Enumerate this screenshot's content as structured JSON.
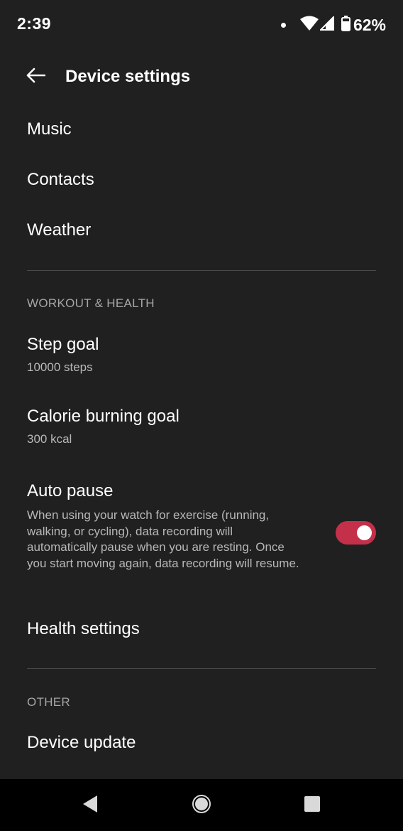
{
  "status_bar": {
    "time": "2:39",
    "battery": "62%"
  },
  "header": {
    "title": "Device settings"
  },
  "items_top": [
    {
      "label": "Music"
    },
    {
      "label": "Contacts"
    },
    {
      "label": "Weather"
    }
  ],
  "workout_section": {
    "header": "WORKOUT & HEALTH",
    "step_goal": {
      "title": "Step goal",
      "value": "10000 steps"
    },
    "calorie_goal": {
      "title": "Calorie burning goal",
      "value": "300 kcal"
    },
    "auto_pause": {
      "title": "Auto pause",
      "description": "When using your watch for exercise (running, walking, or cycling), data recording will automatically pause when you are resting. Once you start moving again, data recording will resume.",
      "enabled": true
    },
    "health_settings": {
      "title": "Health settings"
    }
  },
  "other_section": {
    "header": "OTHER",
    "device_update": {
      "title": "Device update"
    }
  },
  "colors": {
    "background": "#202020",
    "accent_toggle": "#c4304a",
    "secondary_text": "#b8b8b8"
  },
  "icons": {
    "back": "arrow-back-icon",
    "wifi": "wifi-icon",
    "signal": "signal-icon",
    "battery": "battery-icon",
    "nav_back": "nav-back-icon",
    "nav_home": "nav-home-icon",
    "nav_recents": "nav-recents-icon"
  }
}
